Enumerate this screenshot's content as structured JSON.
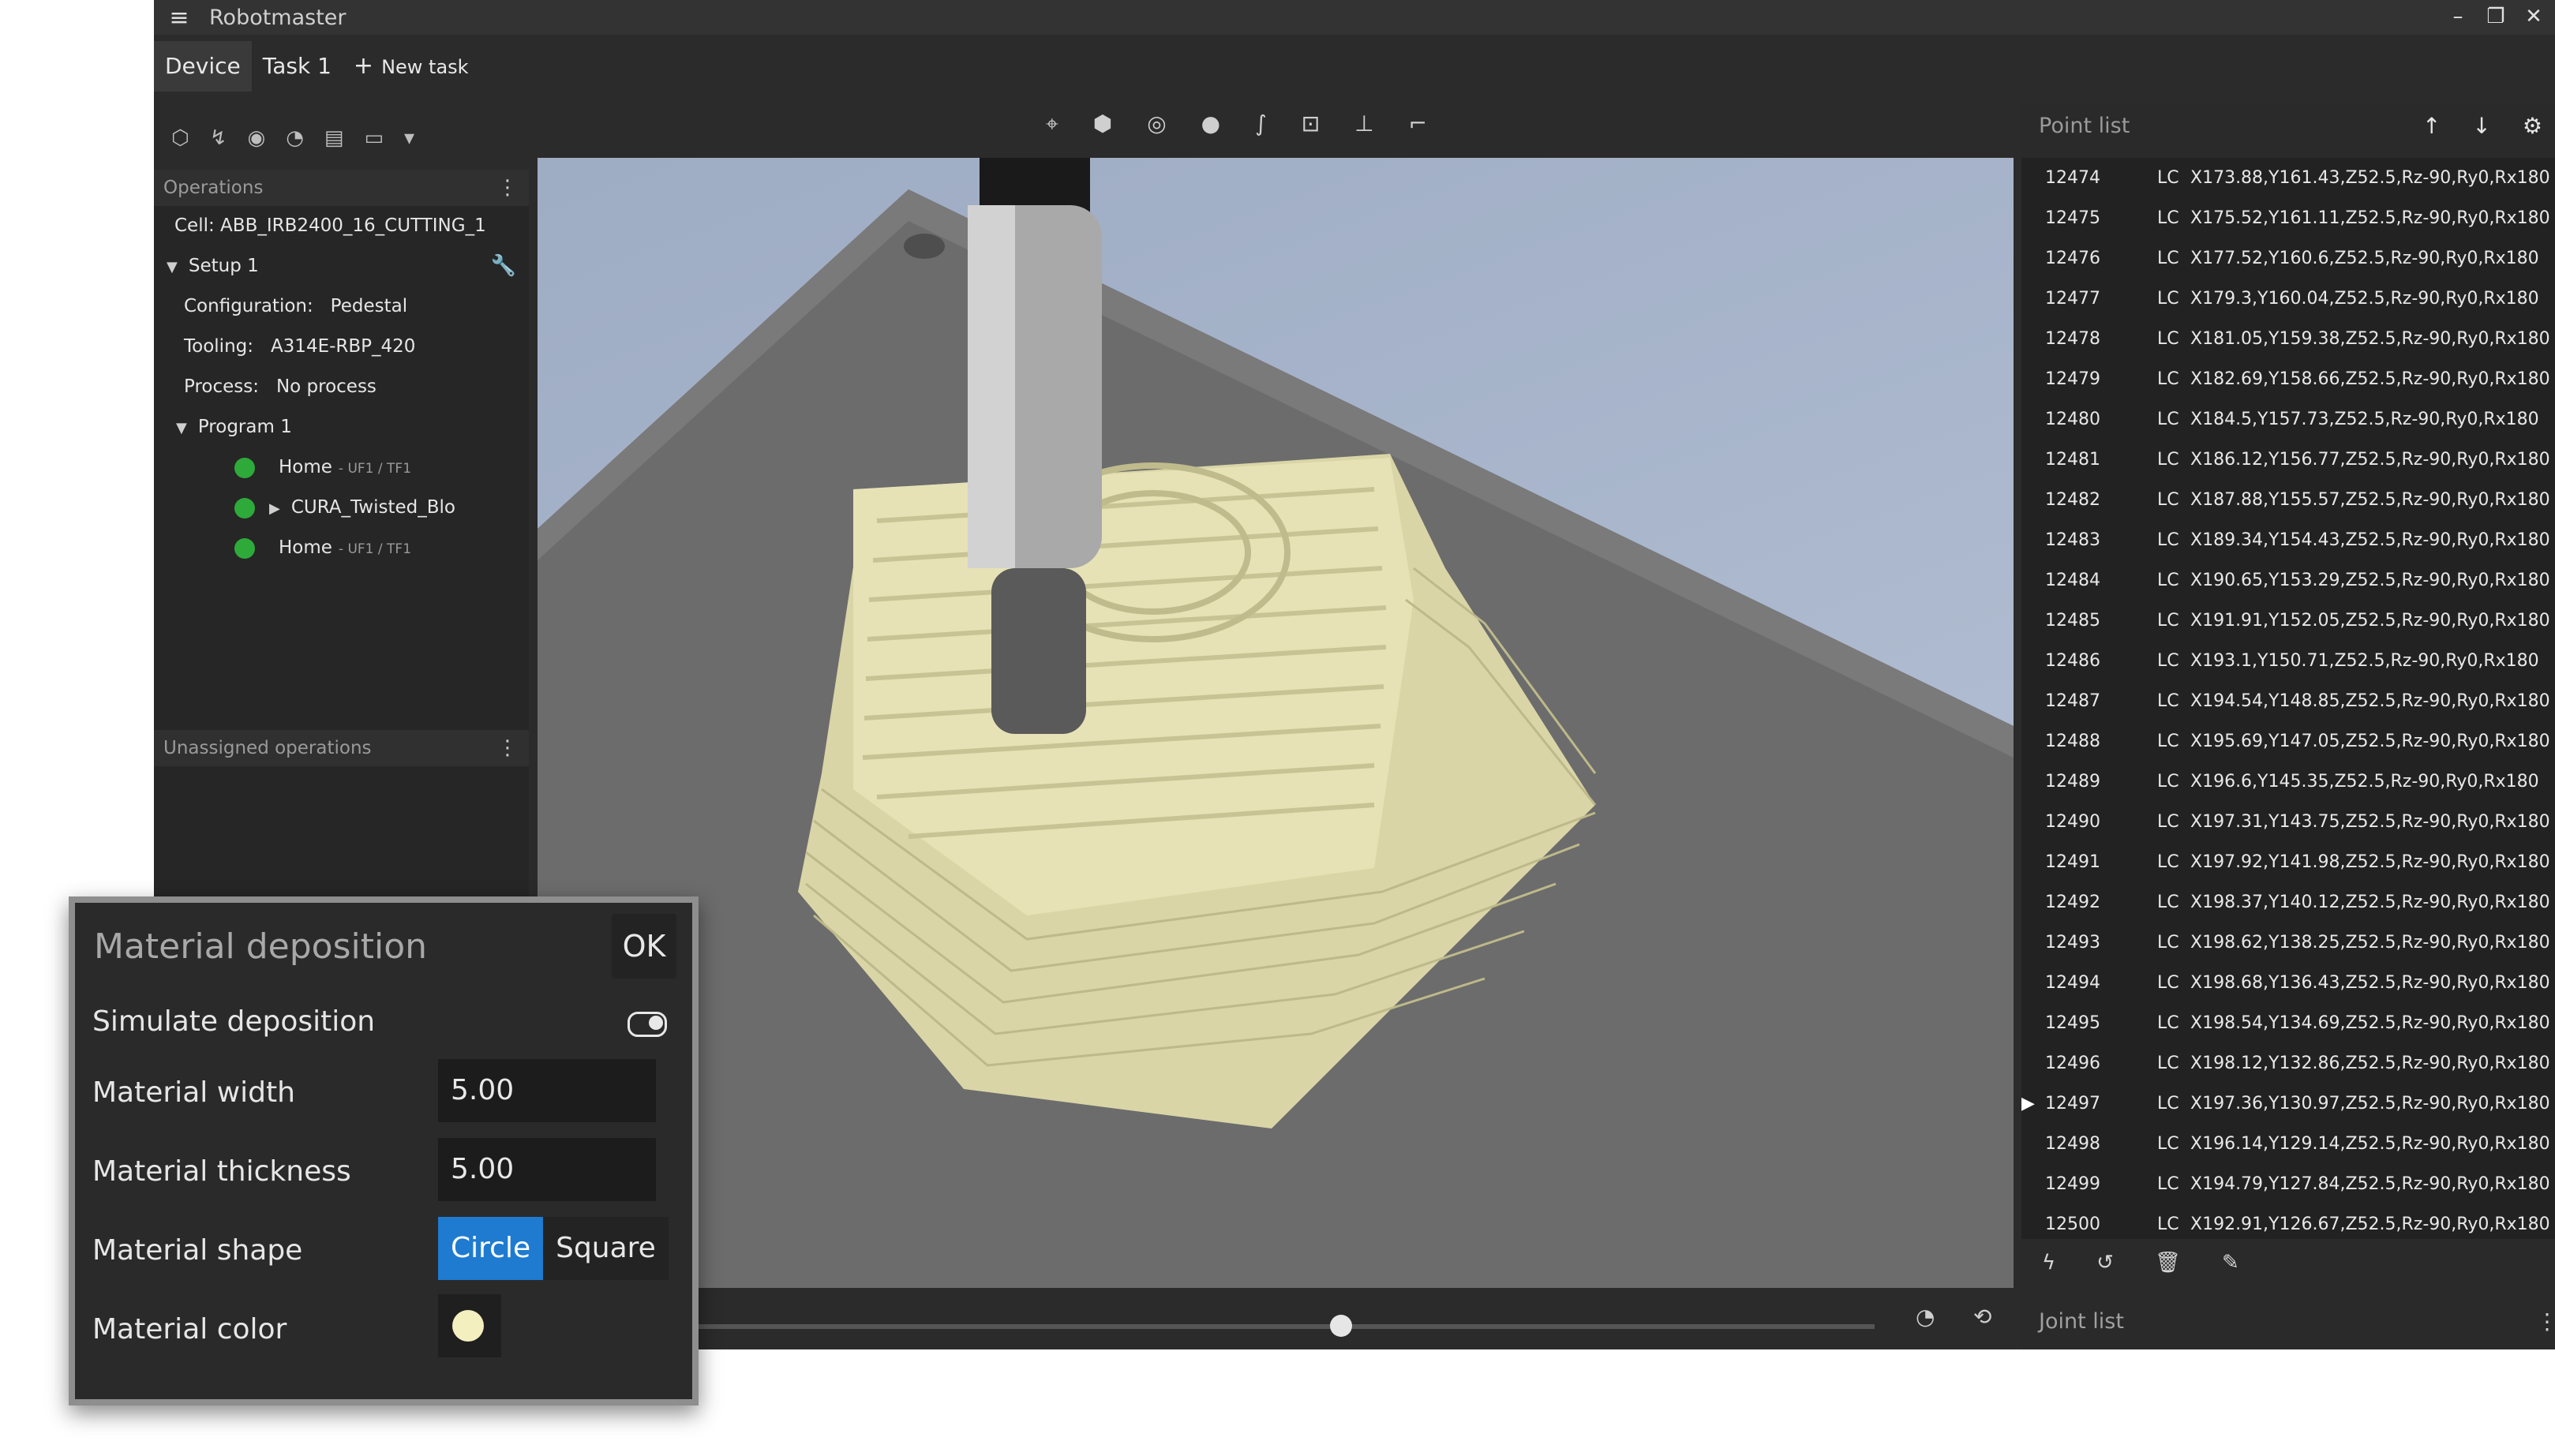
{
  "window": {
    "title": "Robotmaster",
    "menu_icon": "hamburger-icon"
  },
  "tabs": [
    {
      "label": "Device"
    },
    {
      "label": "Task 1"
    },
    {
      "label": "New task"
    }
  ],
  "operations": {
    "header": "Operations",
    "cell": "Cell: ABB_IRB2400_16_CUTTING_1",
    "setup": "Setup 1",
    "configuration": "Configuration:",
    "configuration_value": "Pedestal",
    "tooling": "Tooling:",
    "tooling_value": "A314E-RBP_420",
    "process": "Process:",
    "process_value": "No process",
    "program": "Program 1",
    "items": [
      {
        "label": "Home",
        "frame": "- UF1 / TF1"
      },
      {
        "label": "CURA_Twisted_Blo",
        "frame": ""
      },
      {
        "label": "Home",
        "frame": "- UF1 / TF1"
      }
    ]
  },
  "unassigned": {
    "header": "Unassigned operations"
  },
  "point_list": {
    "header": "Point list",
    "rows": [
      {
        "id": "12474",
        "cls": "LC",
        "val": "X173.88,Y161.43,Z52.5,Rz-90,Ry0,Rx180"
      },
      {
        "id": "12475",
        "cls": "LC",
        "val": "X175.52,Y161.11,Z52.5,Rz-90,Ry0,Rx180"
      },
      {
        "id": "12476",
        "cls": "LC",
        "val": "X177.52,Y160.6,Z52.5,Rz-90,Ry0,Rx180"
      },
      {
        "id": "12477",
        "cls": "LC",
        "val": "X179.3,Y160.04,Z52.5,Rz-90,Ry0,Rx180"
      },
      {
        "id": "12478",
        "cls": "LC",
        "val": "X181.05,Y159.38,Z52.5,Rz-90,Ry0,Rx180"
      },
      {
        "id": "12479",
        "cls": "LC",
        "val": "X182.69,Y158.66,Z52.5,Rz-90,Ry0,Rx180"
      },
      {
        "id": "12480",
        "cls": "LC",
        "val": "X184.5,Y157.73,Z52.5,Rz-90,Ry0,Rx180"
      },
      {
        "id": "12481",
        "cls": "LC",
        "val": "X186.12,Y156.77,Z52.5,Rz-90,Ry0,Rx180"
      },
      {
        "id": "12482",
        "cls": "LC",
        "val": "X187.88,Y155.57,Z52.5,Rz-90,Ry0,Rx180"
      },
      {
        "id": "12483",
        "cls": "LC",
        "val": "X189.34,Y154.43,Z52.5,Rz-90,Ry0,Rx180"
      },
      {
        "id": "12484",
        "cls": "LC",
        "val": "X190.65,Y153.29,Z52.5,Rz-90,Ry0,Rx180"
      },
      {
        "id": "12485",
        "cls": "LC",
        "val": "X191.91,Y152.05,Z52.5,Rz-90,Ry0,Rx180"
      },
      {
        "id": "12486",
        "cls": "LC",
        "val": "X193.1,Y150.71,Z52.5,Rz-90,Ry0,Rx180"
      },
      {
        "id": "12487",
        "cls": "LC",
        "val": "X194.54,Y148.85,Z52.5,Rz-90,Ry0,Rx180"
      },
      {
        "id": "12488",
        "cls": "LC",
        "val": "X195.69,Y147.05,Z52.5,Rz-90,Ry0,Rx180"
      },
      {
        "id": "12489",
        "cls": "LC",
        "val": "X196.6,Y145.35,Z52.5,Rz-90,Ry0,Rx180"
      },
      {
        "id": "12490",
        "cls": "LC",
        "val": "X197.31,Y143.75,Z52.5,Rz-90,Ry0,Rx180"
      },
      {
        "id": "12491",
        "cls": "LC",
        "val": "X197.92,Y141.98,Z52.5,Rz-90,Ry0,Rx180"
      },
      {
        "id": "12492",
        "cls": "LC",
        "val": "X198.37,Y140.12,Z52.5,Rz-90,Ry0,Rx180"
      },
      {
        "id": "12493",
        "cls": "LC",
        "val": "X198.62,Y138.25,Z52.5,Rz-90,Ry0,Rx180"
      },
      {
        "id": "12494",
        "cls": "LC",
        "val": "X198.68,Y136.43,Z52.5,Rz-90,Ry0,Rx180"
      },
      {
        "id": "12495",
        "cls": "LC",
        "val": "X198.54,Y134.69,Z52.5,Rz-90,Ry0,Rx180"
      },
      {
        "id": "12496",
        "cls": "LC",
        "val": "X198.12,Y132.86,Z52.5,Rz-90,Ry0,Rx180"
      },
      {
        "id": "12497",
        "cls": "LC",
        "val": "X197.36,Y130.97,Z52.5,Rz-90,Ry0,Rx180"
      },
      {
        "id": "12498",
        "cls": "LC",
        "val": "X196.14,Y129.14,Z52.5,Rz-90,Ry0,Rx180"
      },
      {
        "id": "12499",
        "cls": "LC",
        "val": "X194.79,Y127.84,Z52.5,Rz-90,Ry0,Rx180"
      },
      {
        "id": "12500",
        "cls": "LC",
        "val": "X192.91,Y126.67,Z52.5,Rz-90,Ry0,Rx180"
      }
    ],
    "current_id": "12497"
  },
  "joint_list": {
    "header": "Joint list"
  },
  "dialog": {
    "title": "Material deposition",
    "ok": "OK",
    "simulate_label": "Simulate deposition",
    "width_label": "Material width",
    "width_value": "5.00",
    "thickness_label": "Material thickness",
    "thickness_value": "5.00",
    "shape_label": "Material shape",
    "shape_options": [
      "Circle",
      "Square"
    ],
    "shape_selected": "Circle",
    "color_label": "Material color",
    "color_value": "#f3efbf"
  },
  "colors": {
    "accent": "#1e7bd0",
    "status_ok": "#2eaa3a",
    "scroll_marker": "#f0a020"
  },
  "timeline": {
    "position_fraction": 0.54
  }
}
